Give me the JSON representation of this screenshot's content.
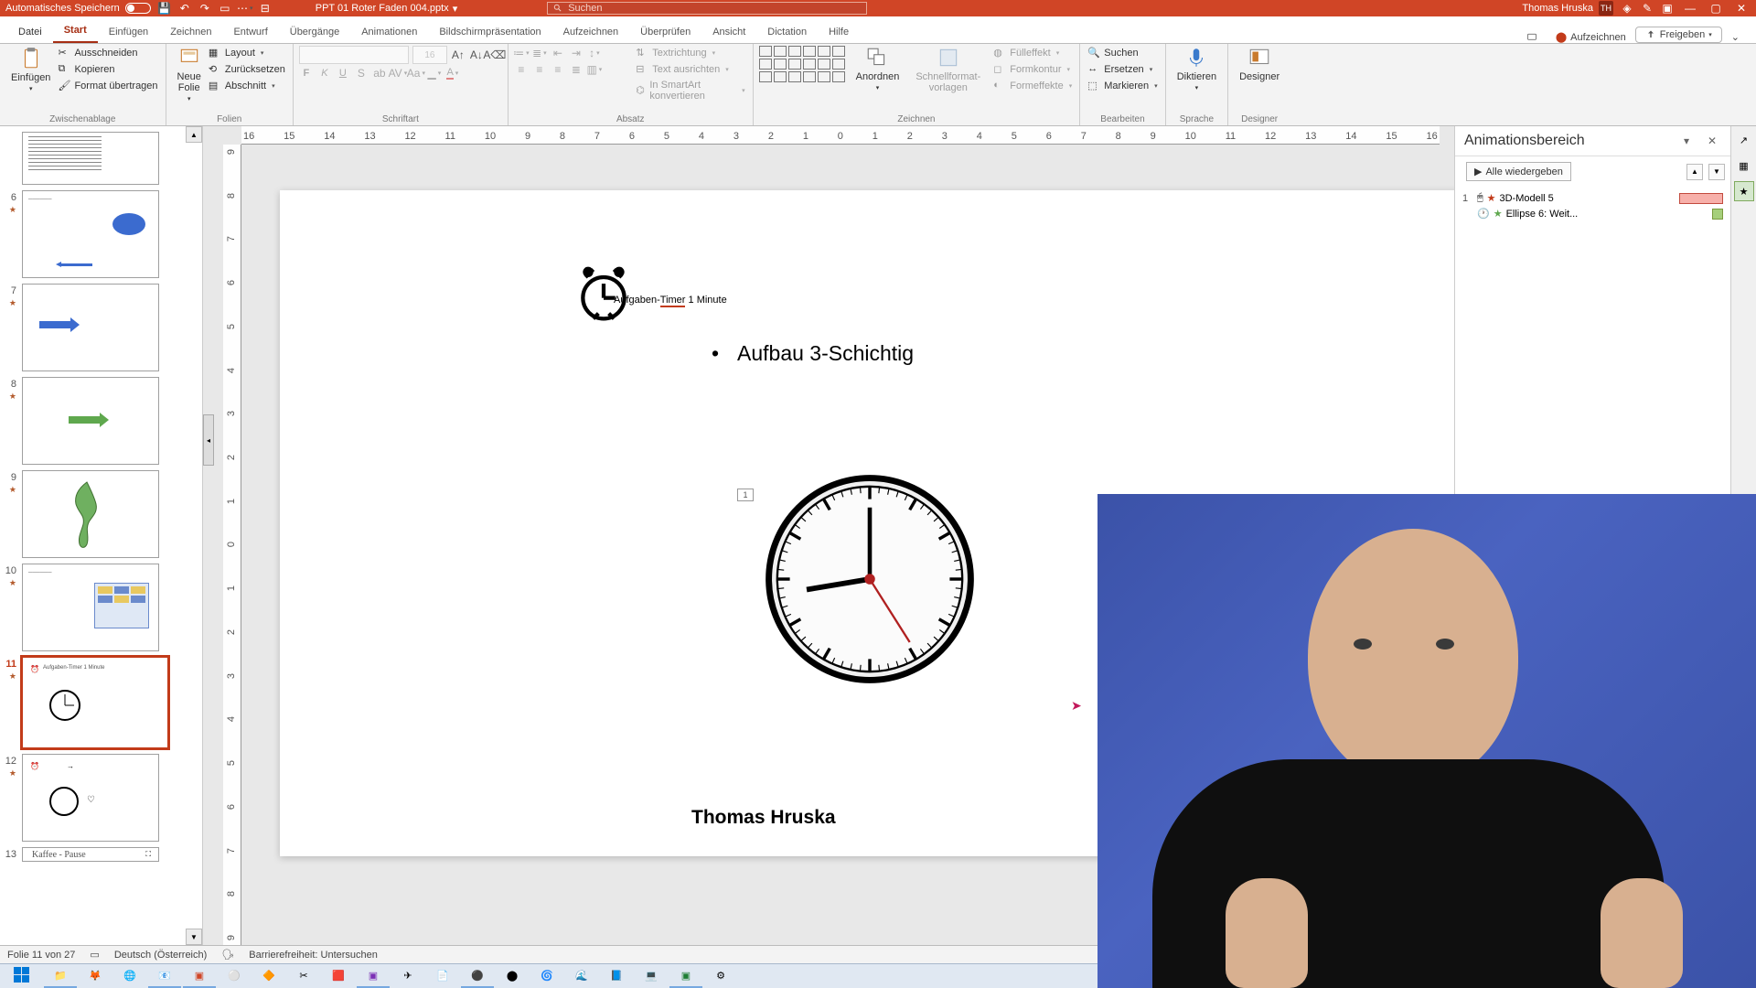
{
  "titlebar": {
    "autosave": "Automatisches Speichern",
    "filename": "PPT 01 Roter Faden 004.pptx",
    "search_placeholder": "Suchen",
    "user": "Thomas Hruska",
    "user_initials": "TH"
  },
  "tabs": {
    "file": "Datei",
    "start": "Start",
    "insert": "Einfügen",
    "draw": "Zeichnen",
    "design": "Entwurf",
    "transitions": "Übergänge",
    "animations": "Animationen",
    "slideshow": "Bildschirmpräsentation",
    "record": "Aufzeichnen",
    "review": "Überprüfen",
    "view": "Ansicht",
    "dictation": "Dictation",
    "help": "Hilfe",
    "rec_btn": "Aufzeichnen",
    "share": "Freigeben"
  },
  "ribbon": {
    "clipboard": {
      "paste": "Einfügen",
      "cut": "Ausschneiden",
      "copy": "Kopieren",
      "format_painter": "Format übertragen",
      "label": "Zwischenablage"
    },
    "slides": {
      "new_slide": "Neue\nFolie",
      "layout": "Layout",
      "reset": "Zurücksetzen",
      "section": "Abschnitt",
      "label": "Folien"
    },
    "font": {
      "label": "Schriftart",
      "size": "16"
    },
    "paragraph": {
      "label": "Absatz",
      "text_direction": "Textrichtung",
      "align_text": "Text ausrichten",
      "smartart": "In SmartArt konvertieren"
    },
    "drawing": {
      "arrange": "Anordnen",
      "quickstyles": "Schnellformat-\nvorlagen",
      "fill": "Fülleffekt",
      "outline": "Formkontur",
      "effects": "Formeffekte",
      "label": "Zeichnen"
    },
    "editing": {
      "find": "Suchen",
      "replace": "Ersetzen",
      "select": "Markieren",
      "label": "Bearbeiten"
    },
    "voice": {
      "dictate": "Diktieren",
      "label": "Sprache"
    },
    "designer": {
      "btn": "Designer",
      "label": "Designer"
    }
  },
  "hruler": [
    "16",
    "15",
    "14",
    "13",
    "12",
    "11",
    "10",
    "9",
    "8",
    "7",
    "6",
    "5",
    "4",
    "3",
    "2",
    "1",
    "0",
    "1",
    "2",
    "3",
    "4",
    "5",
    "6",
    "7",
    "8",
    "9",
    "10",
    "11",
    "12",
    "13",
    "14",
    "15",
    "16"
  ],
  "vruler": [
    "9",
    "8",
    "7",
    "6",
    "5",
    "4",
    "3",
    "2",
    "1",
    "0",
    "1",
    "2",
    "3",
    "4",
    "5",
    "6",
    "7",
    "8",
    "9"
  ],
  "thumbs": [
    {
      "n": "6"
    },
    {
      "n": "7"
    },
    {
      "n": "8"
    },
    {
      "n": "9"
    },
    {
      "n": "10"
    },
    {
      "n": "11"
    },
    {
      "n": "12"
    },
    {
      "n": "13",
      "label": "Kaffee - Pause"
    }
  ],
  "slide": {
    "title_pre": "Aufgaben-",
    "title_u": "Timer",
    "title_post": " 1 Minute",
    "bullet": "Aufbau 3-Schichtig",
    "animtag": "1",
    "author": "Thomas Hruska"
  },
  "animpane": {
    "title": "Animationsbereich",
    "play_all": "Alle wiedergeben",
    "items": [
      {
        "idx": "1",
        "name": "3D-Modell 5"
      },
      {
        "idx": "",
        "name": "Ellipse 6: Weit..."
      }
    ]
  },
  "status": {
    "slide": "Folie 11 von 27",
    "lang": "Deutsch (Österreich)",
    "a11y": "Barrierefreiheit: Untersuchen"
  }
}
